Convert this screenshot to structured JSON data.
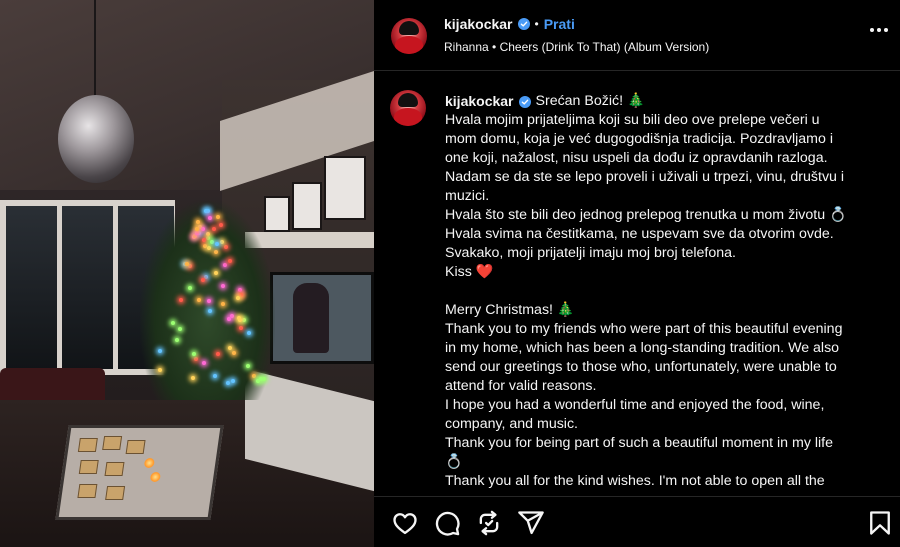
{
  "post": {
    "username": "kijakockar",
    "follow_label": "Prati",
    "audio": "Rihanna • Cheers (Drink To That) (Album Version)",
    "caption_title": "Srećan Božić! 🎄",
    "caption_lines": [
      "Hvala mojim prijateljima koji su bili deo ove prelepe večeri u",
      "mom domu, koja je već dugogodišnja tradicija. Pozdravljamo i",
      "one koji, nažalost, nisu uspeli da dođu iz opravdanih razloga.",
      "Nadam se da ste se lepo proveli i uživali u trpezi, vinu, društvu i",
      "muzici.",
      "Hvala što ste bili deo jednog prelepog trenutka u mom životu 💍",
      "Hvala svima na čestitkama, ne uspevam sve da otvorim ovde.",
      "Svakako, moji prijatelji imaju moj broj telefona.",
      "Kiss ❤️",
      "",
      "Merry Christmas! 🎄",
      "Thank you to my friends who were part of this beautiful evening",
      "in my home, which has been a long-standing tradition. We also",
      "send our greetings to those who, unfortunately, were unable to",
      "attend for valid reasons.",
      "I hope you had a wonderful time and enjoyed the food, wine,",
      "company, and music.",
      "Thank you for being part of such a beautiful moment in my life",
      "💍",
      "Thank you all for the kind wishes. I'm not able to open all the"
    ]
  },
  "icons": {
    "verified": "verified-badge-icon",
    "more": "more-options-icon",
    "like": "heart-icon",
    "comment": "comment-icon",
    "repost": "repost-icon",
    "share": "share-icon",
    "save": "bookmark-icon"
  },
  "colors": {
    "background": "#000000",
    "text": "#f5f5f5",
    "accent": "#4a9bf6",
    "divider": "#262626"
  }
}
